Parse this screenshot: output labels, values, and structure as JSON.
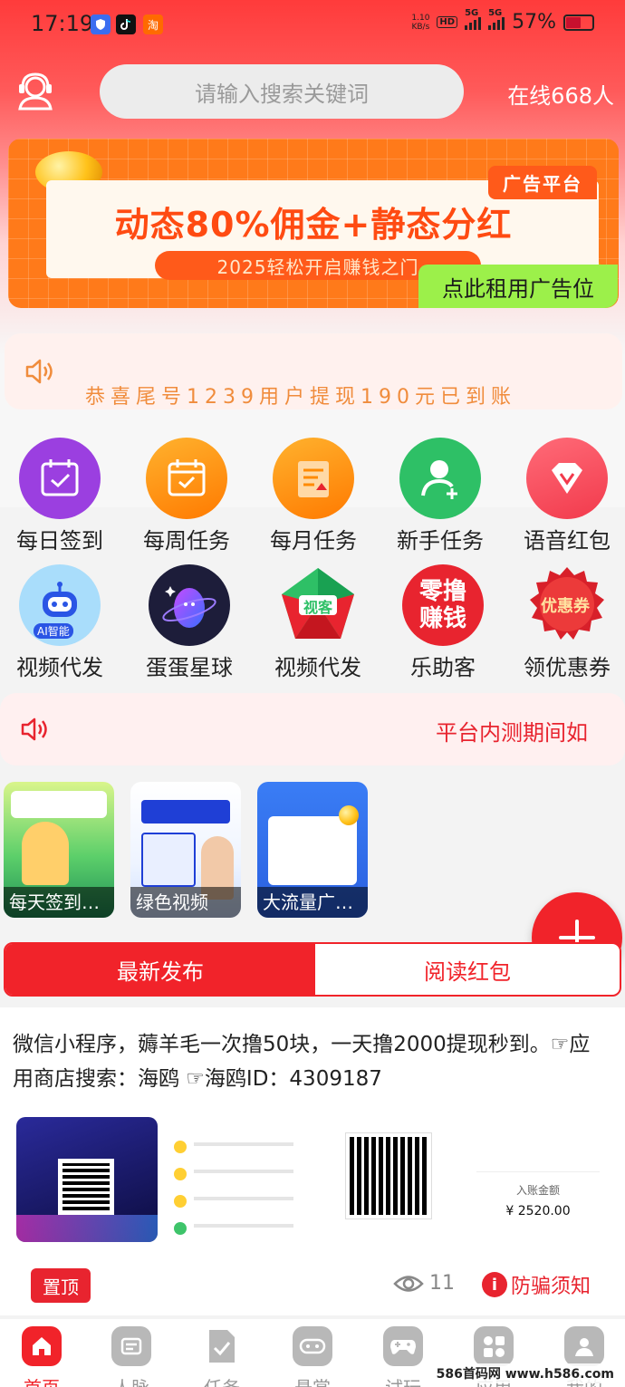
{
  "status_bar": {
    "time": "17:19",
    "apps": [
      "shield-app",
      "tiktok-app",
      "taobao-app"
    ],
    "taobao_glyph": "淘",
    "net_speed_value": "1.10",
    "net_speed_unit": "KB/s",
    "hd_tag": "HD",
    "sim1": "5G",
    "sim2": "5G",
    "battery": "57%"
  },
  "header": {
    "search_placeholder": "请输入搜索关键词",
    "online_text": "在线668人"
  },
  "banner": {
    "tag": "广告平台",
    "headline": "动态80%佣金+静态分红",
    "subline": "2025轻松开启赚钱之门",
    "cta": "点此租用广告位",
    "accent": "#ff7a1a"
  },
  "notice1": {
    "text": "恭喜尾号1239用户提现190元已到账"
  },
  "grid": [
    {
      "label": "每日签到",
      "icon": "calendar-check-icon",
      "color": "#9b3fe0"
    },
    {
      "label": "每周任务",
      "icon": "calendar-week-icon",
      "color": "#ff8a00"
    },
    {
      "label": "每月任务",
      "icon": "document-up-icon",
      "color": "#ff8a00"
    },
    {
      "label": "新手任务",
      "icon": "user-add-icon",
      "color": "#2ec066"
    },
    {
      "label": "语音红包",
      "icon": "diamond-icon",
      "color": "#ff4d5e"
    },
    {
      "label": "视频代发",
      "icon": "ai-robot-icon",
      "color": "#a9ddfb"
    },
    {
      "label": "蛋蛋星球",
      "icon": "planet-egg-icon",
      "color": "#1d1d3a"
    },
    {
      "label": "视频代发",
      "icon": "pentagon-logo-icon",
      "color": "#ffffff"
    },
    {
      "label": "乐助客",
      "icon": "zero-earn-icon",
      "color": "#e8242f"
    },
    {
      "label": "领优惠券",
      "icon": "coupon-seal-icon",
      "color": "#e8242f"
    }
  ],
  "grid_badges": {
    "ai": "AI智能",
    "pentagon": "视客",
    "zero_line1": "零撸",
    "zero_line2": "赚钱",
    "coupon": "优惠券"
  },
  "notice2": {
    "text": "平台内测期间如"
  },
  "thumbs": [
    {
      "caption": "每天签到…"
    },
    {
      "caption": "绿色视频"
    },
    {
      "caption": "大流量广…"
    }
  ],
  "tabs": {
    "active": "最新发布",
    "inactive": "阅读红包"
  },
  "post": {
    "text": "微信小程序，薅羊毛一次撸50块，一天撸2000提现秒到。☞应用商店搜索：海鸥 ☞海鸥ID：4309187",
    "pin_label": "置顶",
    "views": "11",
    "fraud_label": "防骗须知",
    "receipt_title": "入账金额",
    "receipt_amount": "¥ 2520.00"
  },
  "bottom_nav": [
    {
      "label": "首页",
      "icon": "home-icon",
      "active": true
    },
    {
      "label": "人脉",
      "icon": "contacts-icon",
      "active": false
    },
    {
      "label": "任务",
      "icon": "task-icon",
      "active": false
    },
    {
      "label": "悬赏",
      "icon": "gamepad-icon",
      "active": false
    },
    {
      "label": "试玩",
      "icon": "controller-icon",
      "active": false
    },
    {
      "label": "应用",
      "icon": "apps-icon",
      "active": false
    },
    {
      "label": "我的",
      "icon": "profile-icon",
      "active": false
    }
  ],
  "watermark": "586首码网 www.h586.com",
  "colors": {
    "primary": "#f1232a",
    "notice_orange": "#f08c3c",
    "lime": "#9cf04a"
  }
}
